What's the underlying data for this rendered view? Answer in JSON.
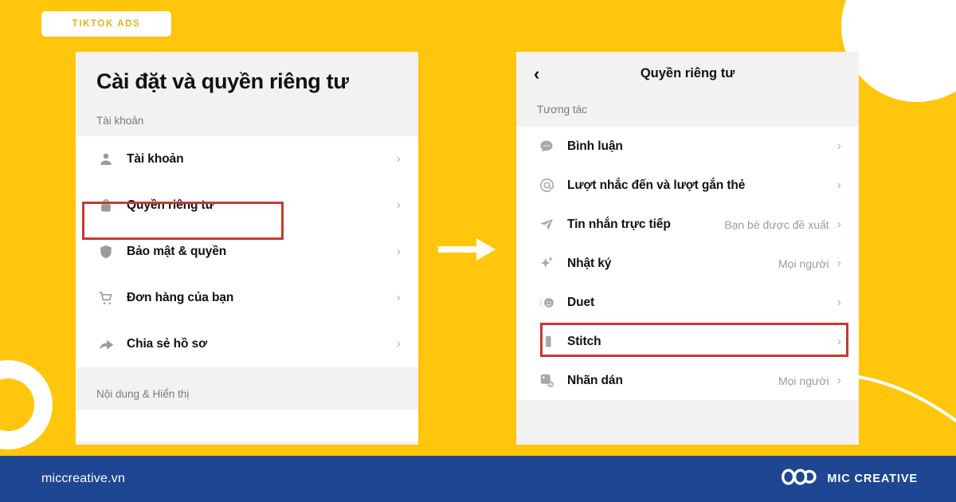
{
  "theme": {
    "background": "#FFC60B",
    "footer_bg": "#1E4692",
    "highlight_red": "#C53A33",
    "badge_text_color": "#E8B016",
    "panel_bg": "#F2F2F2",
    "card_bg": "#FFFFFF"
  },
  "badge": {
    "label": "TIKTOK ADS"
  },
  "left_panel": {
    "title": "Cài đặt và quyền riêng tư",
    "section_account": "Tài khoản",
    "section_content": "Nội dung & Hiển thị",
    "rows": [
      {
        "icon": "person-icon",
        "label": "Tài khoản",
        "value": "",
        "chevron": "›",
        "highlighted": false
      },
      {
        "icon": "lock-icon",
        "label": "Quyền riêng tư",
        "value": "",
        "chevron": "›",
        "highlighted": true
      },
      {
        "icon": "shield-icon",
        "label": "Bảo mật & quyền",
        "value": "",
        "chevron": "›",
        "highlighted": false
      },
      {
        "icon": "cart-icon",
        "label": "Đơn hàng của bạn",
        "value": "",
        "chevron": "›",
        "highlighted": false
      },
      {
        "icon": "share-icon",
        "label": "Chia sẻ hồ sơ",
        "value": "",
        "chevron": "›",
        "highlighted": false
      }
    ]
  },
  "right_panel": {
    "back_chevron": "‹",
    "title": "Quyền riêng tư",
    "section_interaction": "Tương tác",
    "rows": [
      {
        "icon": "comment-icon",
        "label": "Bình luận",
        "value": "",
        "chevron": "›",
        "highlighted": false
      },
      {
        "icon": "mention-icon",
        "label": "Lượt nhắc đến và lượt gắn thẻ",
        "value": "",
        "chevron": "›",
        "highlighted": false
      },
      {
        "icon": "send-icon",
        "label": "Tin nhắn trực tiếp",
        "value": "Bạn bè được đề xuất",
        "chevron": "›",
        "highlighted": false
      },
      {
        "icon": "sparkle-icon",
        "label": "Nhật ký",
        "value": "Mọi người",
        "chevron": "›",
        "highlighted": false
      },
      {
        "icon": "duet-icon",
        "label": "Duet",
        "value": "",
        "chevron": "›",
        "highlighted": true
      },
      {
        "icon": "stitch-icon",
        "label": "Stitch",
        "value": "",
        "chevron": "›",
        "highlighted": false
      },
      {
        "icon": "sticker-icon",
        "label": "Nhãn dán",
        "value": "Mọi người",
        "chevron": "›",
        "highlighted": false
      }
    ]
  },
  "arrow": {
    "name": "step-arrow-icon"
  },
  "footer": {
    "site": "miccreative.vn",
    "brand_name": "MIC CREATIVE",
    "logo": "mic-creative-infinity-logo"
  }
}
